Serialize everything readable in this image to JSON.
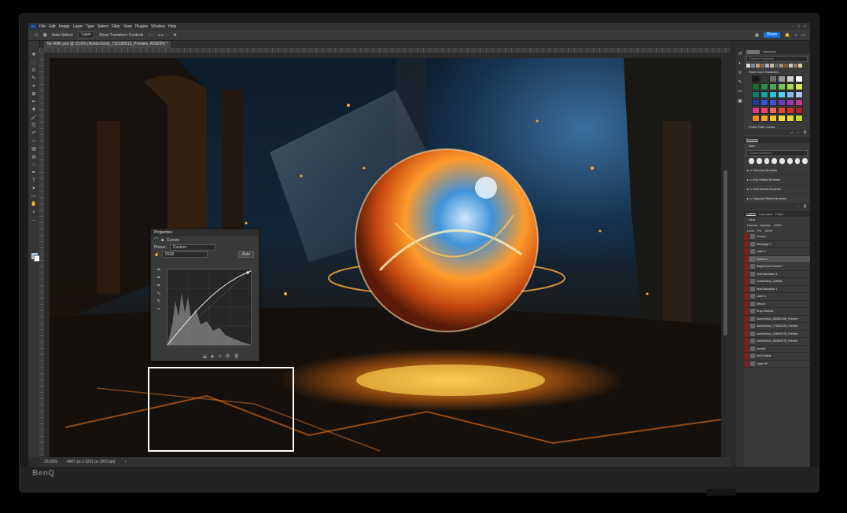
{
  "brand": "BenQ",
  "app_icon": "Ps",
  "menu": [
    "File",
    "Edit",
    "Image",
    "Layer",
    "Type",
    "Select",
    "Filter",
    "View",
    "Plugins",
    "Window",
    "Help"
  ],
  "options": {
    "auto_select": "Auto-Select:",
    "layer_mode": "Layer",
    "show_transform": "Show Transform Controls",
    "share": "Share"
  },
  "document": {
    "tab_title": "5k-4096.psd @ 23.6% (AdobeStock_715185813_Preview, RGB/8#) *",
    "zoom": "23.63%",
    "size": "4907 px x 3311 px (300 ppi)"
  },
  "properties": {
    "title": "Properties",
    "type": "Curves",
    "preset_label": "Preset:",
    "preset": "Custom",
    "channel": "RGB",
    "auto": "Auto"
  },
  "swatches": {
    "tabs": [
      "Swatches",
      "Navigator"
    ],
    "search": "Search Swatches",
    "group_paint": "Paint Color Swatches",
    "group_photo": "Photo Filter Colors",
    "recent": [
      "#e8dcc8",
      "#6b8ca6",
      "#c6a27a",
      "#8b6a4a",
      "#9fb5c8",
      "#d8b48a",
      "#4d6b85",
      "#b89060",
      "#7a5a3c",
      "#c0c8d0",
      "#a07850",
      "#dccaa8"
    ],
    "colors": [
      "#1a1a1a",
      "#3a3a3a",
      "#6d6d6d",
      "#9a9a9a",
      "#cfcfcf",
      "#ffffff",
      "#1e6b3a",
      "#2e8a4a",
      "#4fa65a",
      "#7cc25a",
      "#a7d84a",
      "#d9e84a",
      "#0f7a6e",
      "#17a3a0",
      "#2bc2d8",
      "#5ad0f0",
      "#89b8e8",
      "#b0c8f0",
      "#1f3f9a",
      "#2e5ad0",
      "#4a4fd8",
      "#6a3fc0",
      "#9a3aa8",
      "#c03a98",
      "#e23a8a",
      "#f04a6a",
      "#f26a5a",
      "#e84a2e",
      "#d8342a",
      "#b8202a",
      "#f28a2a",
      "#f5a623",
      "#f7c22a",
      "#f5dd3a",
      "#e8e02a",
      "#c8d82a"
    ]
  },
  "brushes": {
    "title": "Brushes",
    "size_label": "Size:",
    "search": "Search Brushes",
    "folders": [
      "General Brushes",
      "Dry Media Brushes",
      "Wet Media Brushes",
      "Special Effects Brushes"
    ]
  },
  "layers": {
    "tabs": [
      "Layers",
      "Channels",
      "Paths"
    ],
    "kind": "Kind",
    "blend": "Normal",
    "opacity_label": "Opacity:",
    "opacity": "100%",
    "fill_label": "Fill:",
    "fill": "100%",
    "lock_label": "Lock:",
    "items": [
      {
        "name": "Group 1",
        "sel": false
      },
      {
        "name": "Rectangle 1",
        "sel": false
      },
      {
        "name": "Layer 3",
        "sel": false
      },
      {
        "name": "Curves 1",
        "sel": true
      },
      {
        "name": "Brightness/Contrast 1",
        "sel": false
      },
      {
        "name": "Hue/Saturation 3",
        "sel": false
      },
      {
        "name": "shutterstock_349826",
        "sel": false
      },
      {
        "name": "Hue/Saturation 1",
        "sel": false
      },
      {
        "name": "Layer 4",
        "sel": false
      },
      {
        "name": "Effects",
        "sel": false
      },
      {
        "name": "Drop Shadow",
        "sel": false
      },
      {
        "name": "AdobeStock_583891186_Preview",
        "sel": false
      },
      {
        "name": "AdobeStock_778321493_Preview",
        "sel": false
      },
      {
        "name": "AdobeStock_248902076_Preview",
        "sel": false
      },
      {
        "name": "AdobeStock_694863276_Preview",
        "sel": false
      },
      {
        "name": "models",
        "sel": false
      },
      {
        "name": "Red Outline",
        "sel": false
      },
      {
        "name": "Layer 99",
        "sel": false
      }
    ]
  }
}
